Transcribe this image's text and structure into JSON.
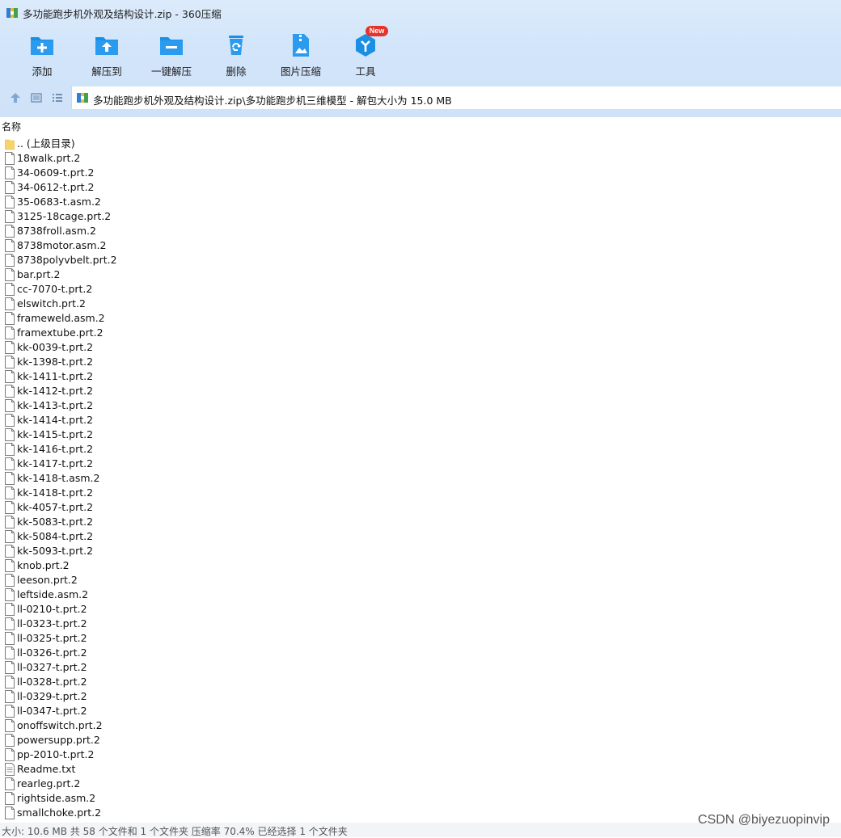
{
  "window": {
    "title": "多功能跑步机外观及结构设计.zip - 360压缩"
  },
  "toolbar": {
    "buttons": [
      {
        "label": "添加",
        "icon": "add-icon"
      },
      {
        "label": "解压到",
        "icon": "extract-to-icon"
      },
      {
        "label": "一键解压",
        "icon": "one-click-extract-icon"
      },
      {
        "label": "删除",
        "icon": "recycle-delete-icon"
      },
      {
        "label": "图片压缩",
        "icon": "image-compress-icon"
      },
      {
        "label": "工具",
        "icon": "tools-icon"
      }
    ],
    "new_badge": "New"
  },
  "address": {
    "path": "多功能跑步机外观及结构设计.zip\\多功能跑步机三维模型 - 解包大小为 15.0 MB"
  },
  "columns": {
    "name": "名称"
  },
  "files": [
    {
      "name": ".. (上级目录)",
      "type": "folder"
    },
    {
      "name": "18walk.prt.2",
      "type": "file"
    },
    {
      "name": "34-0609-t.prt.2",
      "type": "file"
    },
    {
      "name": "34-0612-t.prt.2",
      "type": "file"
    },
    {
      "name": "35-0683-t.asm.2",
      "type": "file"
    },
    {
      "name": "3125-18cage.prt.2",
      "type": "file"
    },
    {
      "name": "8738froll.asm.2",
      "type": "file"
    },
    {
      "name": "8738motor.asm.2",
      "type": "file"
    },
    {
      "name": "8738polyvbelt.prt.2",
      "type": "file"
    },
    {
      "name": "bar.prt.2",
      "type": "file"
    },
    {
      "name": "cc-7070-t.prt.2",
      "type": "file"
    },
    {
      "name": "elswitch.prt.2",
      "type": "file"
    },
    {
      "name": "frameweld.asm.2",
      "type": "file"
    },
    {
      "name": "framextube.prt.2",
      "type": "file"
    },
    {
      "name": "kk-0039-t.prt.2",
      "type": "file"
    },
    {
      "name": "kk-1398-t.prt.2",
      "type": "file"
    },
    {
      "name": "kk-1411-t.prt.2",
      "type": "file"
    },
    {
      "name": "kk-1412-t.prt.2",
      "type": "file"
    },
    {
      "name": "kk-1413-t.prt.2",
      "type": "file"
    },
    {
      "name": "kk-1414-t.prt.2",
      "type": "file"
    },
    {
      "name": "kk-1415-t.prt.2",
      "type": "file"
    },
    {
      "name": "kk-1416-t.prt.2",
      "type": "file"
    },
    {
      "name": "kk-1417-t.prt.2",
      "type": "file"
    },
    {
      "name": "kk-1418-t.asm.2",
      "type": "file"
    },
    {
      "name": "kk-1418-t.prt.2",
      "type": "file"
    },
    {
      "name": "kk-4057-t.prt.2",
      "type": "file"
    },
    {
      "name": "kk-5083-t.prt.2",
      "type": "file"
    },
    {
      "name": "kk-5084-t.prt.2",
      "type": "file"
    },
    {
      "name": "kk-5093-t.prt.2",
      "type": "file"
    },
    {
      "name": "knob.prt.2",
      "type": "file"
    },
    {
      "name": "leeson.prt.2",
      "type": "file"
    },
    {
      "name": "leftside.asm.2",
      "type": "file"
    },
    {
      "name": "ll-0210-t.prt.2",
      "type": "file"
    },
    {
      "name": "ll-0323-t.prt.2",
      "type": "file"
    },
    {
      "name": "ll-0325-t.prt.2",
      "type": "file"
    },
    {
      "name": "ll-0326-t.prt.2",
      "type": "file"
    },
    {
      "name": "ll-0327-t.prt.2",
      "type": "file"
    },
    {
      "name": "ll-0328-t.prt.2",
      "type": "file"
    },
    {
      "name": "ll-0329-t.prt.2",
      "type": "file"
    },
    {
      "name": "ll-0347-t.prt.2",
      "type": "file"
    },
    {
      "name": "onoffswitch.prt.2",
      "type": "file"
    },
    {
      "name": "powersupp.prt.2",
      "type": "file"
    },
    {
      "name": "pp-2010-t.prt.2",
      "type": "file"
    },
    {
      "name": "Readme.txt",
      "type": "text"
    },
    {
      "name": "rearleg.prt.2",
      "type": "file"
    },
    {
      "name": "rightside.asm.2",
      "type": "file"
    },
    {
      "name": "smallchoke.prt.2",
      "type": "file"
    }
  ],
  "status": {
    "text": "大小: 10.6 MB 共 58 个文件和 1 个文件夹 压缩率 70.4% 已经选择 1 个文件夹"
  },
  "watermark": "CSDN @biyezuopinvip",
  "colors": {
    "toolbar_bg": "#d2e5fa",
    "icon_blue": "#1a8fe3",
    "badge_red": "#e8312a",
    "folder_yellow": "#f6d46b"
  }
}
